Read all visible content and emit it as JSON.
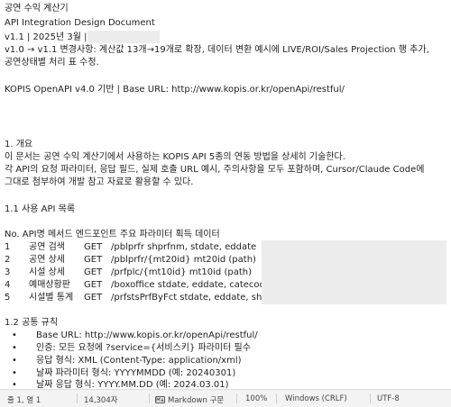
{
  "document": {
    "title": "공연 수익 계산기",
    "subtitle": "API Integration Design Document",
    "version_line": "v1.1  |  2025년 3월  |",
    "changelog_line1": "v1.0 → v1.1 변경사항: 계산값 13개→19개로 확장, 데이터 변환 예시에 LIVE/ROI/Sales Projection 행 추가,",
    "changelog_line2": "공연상태별 처리 표 수정.",
    "api_line": "KOPIS OpenAPI v4.0 기반  |  Base URL: http://www.kopis.or.kr/openApi/restful/",
    "section1_title": "1. 개요",
    "section1_para1": "이 문서는 공연 수익 계산기에서 사용하는 KOPIS API 5종의 연동 방법을 상세히 기술한다.",
    "section1_para2": "각 API의 요청 파라미터, 응답 필드, 실제 호출 URL 예시, 주의사항을 모두 포함하며, Cursor/Claude Code에",
    "section1_para3": "그대로 첨부하여 개발 참고 자료로 활용할 수 있다.",
    "section11_title": "1.1 사용 API 목록",
    "table": {
      "header": "No.    API명 메서드         엔드포인트  주요 파라미터       획득 데이터",
      "rows": [
        {
          "no": "1",
          "name": "공연 검색",
          "method": "GET",
          "endpoint": "/pblprfr            shprfnm, stdate, eddate"
        },
        {
          "no": "2",
          "name": "공연 상세",
          "method": "GET",
          "endpoint": "/pblprfr/{mt20id}     mt20id (path)"
        },
        {
          "no": "3",
          "name": "시설 상세",
          "method": "GET",
          "endpoint": "/prfplc/{mt10id}      mt10id (path)"
        },
        {
          "no": "4",
          "name": "예매상황판",
          "method": "GET",
          "endpoint": "/boxoffice     stdate, eddate, catecode"
        },
        {
          "no": "5",
          "name": "시설별 통계",
          "method": "GET",
          "endpoint": "/prfstsPrfByFct      stdate, eddate, sh"
        }
      ]
    },
    "section12_title": "1.2 공통 규칙",
    "bullets": [
      "Base URL: http://www.kopis.or.kr/openApi/restful/",
      "인증: 모든 요청에 ?service={서비스키} 파라미터 필수",
      "응답 형식: XML (Content-Type: application/xml)",
      "날짜 파라미터 형식: YYYYMMDD (예: 20240301)",
      "날짜 응답 형식: YYYY.MM.DD (예: 2024.03.01)"
    ],
    "bullet_symbol": "•"
  },
  "statusbar": {
    "position": "줄 1, 열 1",
    "char_count": "14,304자",
    "language": "Markdown 구문",
    "zoom": "100%",
    "line_ending": "Windows (CRLF)",
    "encoding": "UTF-8",
    "md_icon": "markdown-icon"
  },
  "colors": {
    "text": "#1f1f1f",
    "statusbar_bg": "#f3f3f3",
    "redaction": "#ececec"
  }
}
